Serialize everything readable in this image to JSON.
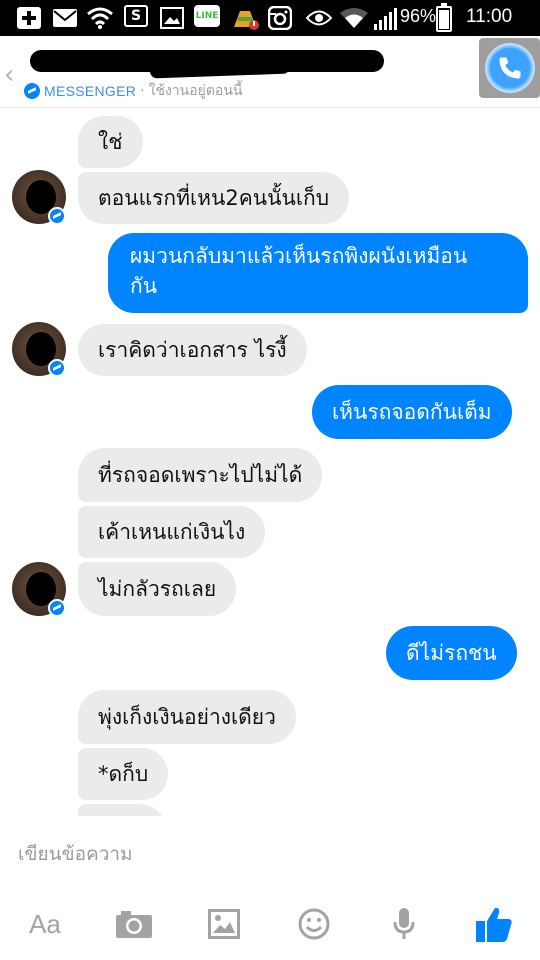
{
  "status_bar": {
    "battery_percent_label": "96%",
    "battery_level": 0.96,
    "time": "11:00",
    "icons": [
      "plus-icon",
      "mail-icon",
      "wifi-signal-icon",
      "s-app-icon",
      "image-icon",
      "line-app-icon",
      "cleaner-icon",
      "instagram-icon",
      "eye-icon",
      "wifi-icon",
      "cell-signal-icon",
      "battery-icon"
    ],
    "line_label": "LINE",
    "s_label": "S"
  },
  "header": {
    "back_glyph": "‹",
    "app_label": "MESSENGER",
    "separator": "·",
    "status_text": "ใช้งานอยู่ตอนนี้",
    "accent_color": "#0084ff"
  },
  "messages": [
    {
      "side": "in",
      "text": "ใช่"
    },
    {
      "side": "in",
      "text": "ตอนแรกที่เหน2คนนั้นเก็บ"
    },
    {
      "side": "out",
      "text": "ผมวนกลับมาแล้วเห็นรถพิงผนังเหมือน"
    },
    {
      "side": "out",
      "text": "กัน"
    },
    {
      "side": "in",
      "text": "เราคิดว่าเอกสาร ไรงี้"
    },
    {
      "side": "out",
      "text": "เห็นรถจอดกันเต็ม"
    },
    {
      "side": "in",
      "text": "ที่รถจอดเพราะไปไม่ได้"
    },
    {
      "side": "in",
      "text": "เค้าเหนแก่เงินไง"
    },
    {
      "side": "in",
      "text": "ไม่กลัวรถเลย"
    },
    {
      "side": "out",
      "text": "ดีไม่รถชน"
    },
    {
      "side": "in",
      "text": "พุ่งเก็งเงินอย่างเดียว"
    },
    {
      "side": "in",
      "text": "*ดก็บ"
    }
  ],
  "composer": {
    "placeholder": "เขียนข้อความ",
    "aa_label": "Aa",
    "tools": [
      "text-format-icon",
      "camera-icon",
      "gallery-icon",
      "sticker-icon",
      "microphone-icon",
      "like-icon"
    ]
  },
  "colors": {
    "outgoing_bubble": "#0084ff",
    "incoming_bubble": "#ebebeb",
    "tool_gray": "#a3a3a3"
  }
}
